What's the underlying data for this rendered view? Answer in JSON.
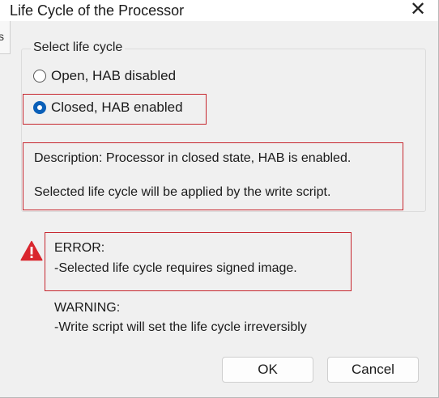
{
  "window": {
    "title": "Life Cycle of the Processor",
    "close_glyph": "✕"
  },
  "background": {
    "partial_text": "s"
  },
  "life_cycle_group": {
    "legend": "Select life cycle",
    "options": [
      {
        "label": "Open, HAB disabled",
        "checked": false
      },
      {
        "label": "Closed, HAB enabled",
        "checked": true
      }
    ],
    "description": "Description: Processor in closed state, HAB is enabled.",
    "note": "Selected life cycle will be applied by the write script."
  },
  "messages": {
    "error_icon": "warning-triangle-icon",
    "error_title": "ERROR:",
    "error_text": " -Selected life cycle requires signed image.",
    "warning_title": "WARNING:",
    "warning_text": " -Write script will set the life cycle irreversibly"
  },
  "buttons": {
    "ok_label": "OK",
    "cancel_label": "Cancel"
  },
  "colors": {
    "highlight_border": "#c6262e",
    "radio_accent": "#0a5fb8",
    "error_icon": "#d9262e"
  }
}
